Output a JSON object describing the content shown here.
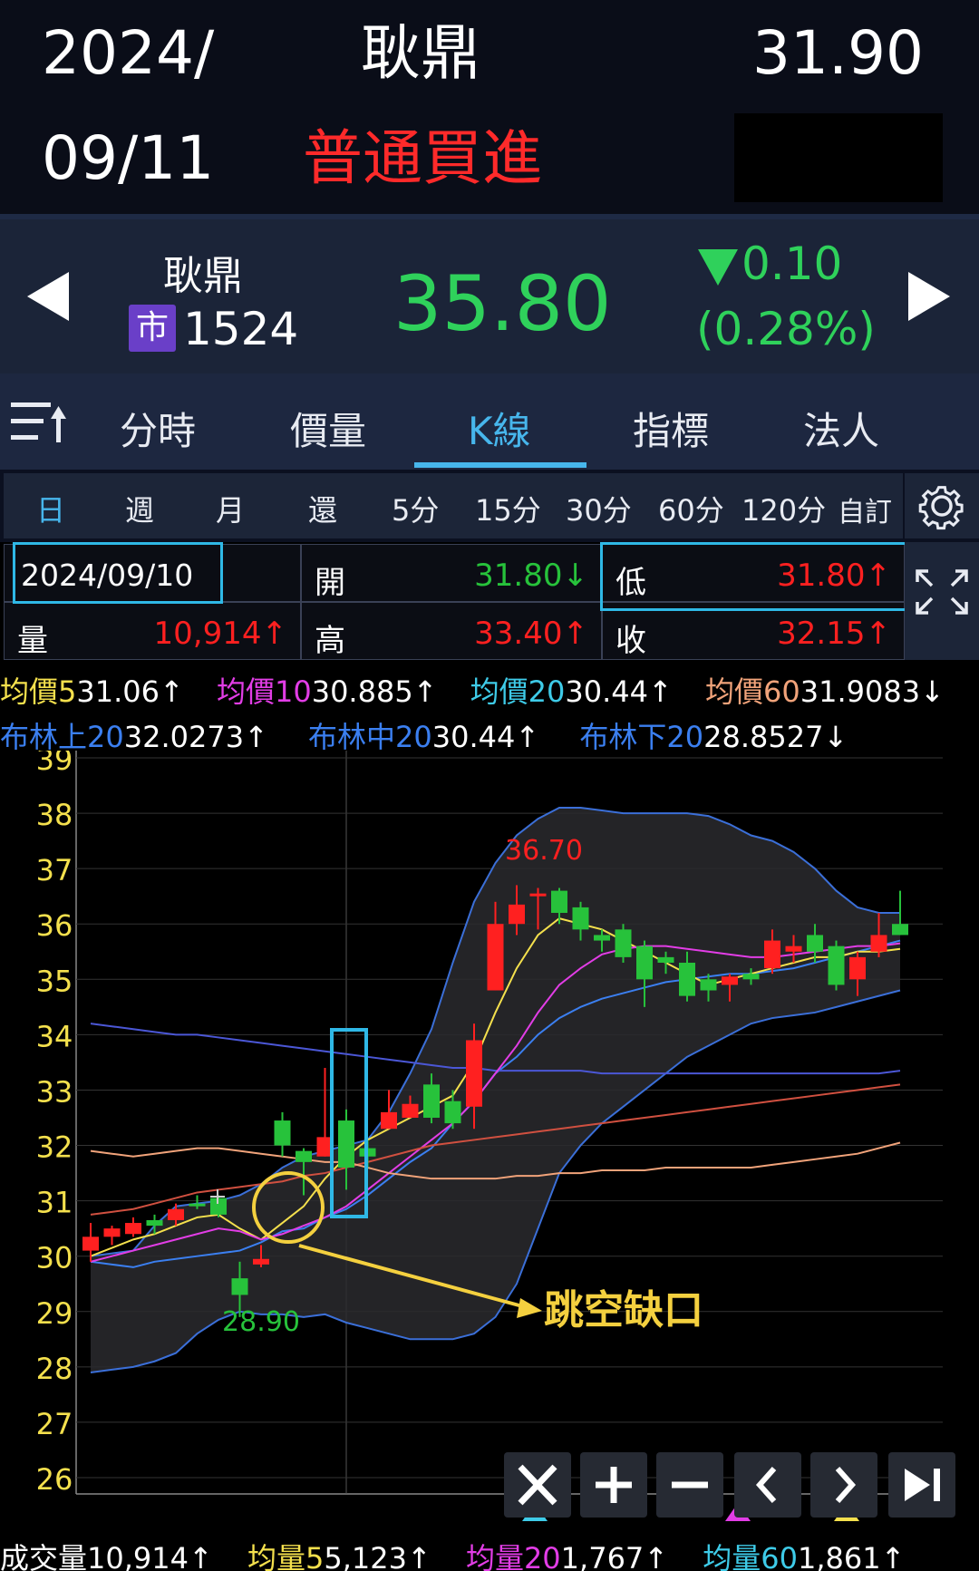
{
  "header": {
    "date_line1": "2024/",
    "date_line2": "09/11",
    "stock_name": "耿鼎",
    "action": "普通買進",
    "price": "31.90"
  },
  "quote": {
    "name": "耿鼎",
    "market_badge": "市",
    "code": "1524",
    "price": "35.80",
    "change": "0.10",
    "change_pct": "(0.28%)"
  },
  "tabs": [
    {
      "label": "分時"
    },
    {
      "label": "價量"
    },
    {
      "label": "K線"
    },
    {
      "label": "指標"
    },
    {
      "label": "法人"
    }
  ],
  "periods": [
    "日",
    "週",
    "月",
    "還",
    "5分",
    "15分",
    "30分",
    "60分",
    "120分"
  ],
  "custom_label": "自訂",
  "info": {
    "date": "2024/09/10",
    "open_label": "開",
    "open": "31.80↓",
    "low_label": "低",
    "low": "31.80↑",
    "vol_label": "量",
    "vol": "10,914↑",
    "high_label": "高",
    "high": "33.40↑",
    "close_label": "收",
    "close": "32.15↑"
  },
  "ma": {
    "ma5_label": "均價5",
    "ma5": "31.06↑",
    "ma10_label": "均價10",
    "ma10": "30.885↑",
    "ma20_label": "均價20",
    "ma20": "30.44↑",
    "ma60_label": "均價60",
    "ma60": "31.9083↓",
    "bu_label": "布林上20",
    "bu": "32.0273↑",
    "bm_label": "布林中20",
    "bm": "30.44↑",
    "bl_label": "布林下20",
    "bl": "28.8527↓"
  },
  "chart_data": {
    "type": "candlestick",
    "y_ticks": [
      "39",
      "38",
      "37",
      "36",
      "35",
      "34",
      "33",
      "32",
      "31",
      "30",
      "29",
      "28",
      "27",
      "26"
    ],
    "ylim": [
      25.5,
      39.1
    ],
    "candles": [
      {
        "o": 30.1,
        "h": 30.6,
        "l": 29.9,
        "c": 30.35,
        "up": true
      },
      {
        "o": 30.35,
        "h": 30.55,
        "l": 30.2,
        "c": 30.5,
        "up": true
      },
      {
        "o": 30.4,
        "h": 30.7,
        "l": 30.35,
        "c": 30.6,
        "up": true
      },
      {
        "o": 30.55,
        "h": 30.75,
        "l": 30.4,
        "c": 30.65,
        "up": false
      },
      {
        "o": 30.65,
        "h": 30.95,
        "l": 30.55,
        "c": 30.85,
        "up": true
      },
      {
        "o": 30.95,
        "h": 31.1,
        "l": 30.85,
        "c": 30.95,
        "up": false
      },
      {
        "o": 31.05,
        "h": 31.1,
        "l": 30.7,
        "c": 30.75,
        "up": false
      },
      {
        "o": 29.6,
        "h": 29.9,
        "l": 28.9,
        "c": 29.3,
        "up": false
      },
      {
        "o": 29.95,
        "h": 30.2,
        "l": 29.8,
        "c": 29.85,
        "up": true
      },
      {
        "o": 32.45,
        "h": 32.6,
        "l": 31.8,
        "c": 32.0,
        "up": false
      },
      {
        "o": 31.7,
        "h": 31.95,
        "l": 31.1,
        "c": 31.9,
        "up": false
      },
      {
        "o": 31.8,
        "h": 33.4,
        "l": 31.8,
        "c": 32.15,
        "up": true
      },
      {
        "o": 32.45,
        "h": 32.65,
        "l": 31.2,
        "c": 31.6,
        "up": false
      },
      {
        "o": 31.8,
        "h": 32.1,
        "l": 31.6,
        "c": 31.95,
        "up": false
      },
      {
        "o": 32.3,
        "h": 33.0,
        "l": 32.3,
        "c": 32.6,
        "up": true
      },
      {
        "o": 32.5,
        "h": 32.9,
        "l": 32.5,
        "c": 32.75,
        "up": true
      },
      {
        "o": 33.1,
        "h": 33.3,
        "l": 32.4,
        "c": 32.5,
        "up": false
      },
      {
        "o": 32.8,
        "h": 33.0,
        "l": 32.3,
        "c": 32.4,
        "up": false
      },
      {
        "o": 32.7,
        "h": 34.2,
        "l": 32.3,
        "c": 33.9,
        "up": true
      },
      {
        "o": 34.8,
        "h": 36.4,
        "l": 34.8,
        "c": 36.0,
        "up": true
      },
      {
        "o": 36.0,
        "h": 36.7,
        "l": 35.8,
        "c": 36.35,
        "up": true
      },
      {
        "o": 36.5,
        "h": 36.65,
        "l": 35.9,
        "c": 36.55,
        "up": true
      },
      {
        "o": 36.6,
        "h": 36.65,
        "l": 36.0,
        "c": 36.2,
        "up": false
      },
      {
        "o": 36.3,
        "h": 36.4,
        "l": 35.7,
        "c": 35.9,
        "up": false
      },
      {
        "o": 35.8,
        "h": 35.9,
        "l": 35.5,
        "c": 35.7,
        "up": false
      },
      {
        "o": 35.9,
        "h": 36.0,
        "l": 35.3,
        "c": 35.4,
        "up": false
      },
      {
        "o": 35.6,
        "h": 35.7,
        "l": 34.5,
        "c": 35.0,
        "up": false
      },
      {
        "o": 35.4,
        "h": 35.5,
        "l": 35.1,
        "c": 35.3,
        "up": false
      },
      {
        "o": 35.3,
        "h": 35.5,
        "l": 34.6,
        "c": 34.7,
        "up": false
      },
      {
        "o": 35.0,
        "h": 35.1,
        "l": 34.6,
        "c": 34.8,
        "up": false
      },
      {
        "o": 34.9,
        "h": 35.1,
        "l": 34.6,
        "c": 35.05,
        "up": true
      },
      {
        "o": 35.1,
        "h": 35.2,
        "l": 34.9,
        "c": 35.0,
        "up": false
      },
      {
        "o": 35.2,
        "h": 35.9,
        "l": 35.1,
        "c": 35.7,
        "up": true
      },
      {
        "o": 35.5,
        "h": 35.8,
        "l": 35.3,
        "c": 35.6,
        "up": true
      },
      {
        "o": 35.8,
        "h": 36.0,
        "l": 35.3,
        "c": 35.5,
        "up": false
      },
      {
        "o": 35.6,
        "h": 35.7,
        "l": 34.8,
        "c": 34.9,
        "up": false
      },
      {
        "o": 35.0,
        "h": 35.5,
        "l": 34.7,
        "c": 35.4,
        "up": true
      },
      {
        "o": 35.5,
        "h": 36.2,
        "l": 35.4,
        "c": 35.8,
        "up": true
      },
      {
        "o": 36.0,
        "h": 36.6,
        "l": 35.8,
        "c": 35.8,
        "up": false
      }
    ],
    "labels": {
      "high": "36.70",
      "low": "28.90",
      "gap": "跳空缺口"
    },
    "series": [
      {
        "name": "布林上20",
        "values": [
          30.0,
          30.05,
          30.1,
          30.55,
          30.9,
          30.95,
          31.0,
          31.1,
          31.3,
          31.6,
          31.8,
          31.9,
          32.0,
          32.1,
          32.6,
          33.3,
          34.1,
          35.3,
          36.4,
          37.1,
          37.6,
          37.9,
          38.1,
          38.1,
          38.05,
          38.0,
          38.0,
          38.0,
          38.0,
          37.95,
          37.8,
          37.6,
          37.5,
          37.3,
          37.0,
          36.6,
          36.3,
          36.2,
          36.2
        ]
      },
      {
        "name": "布林中20",
        "values": [
          29.9,
          29.85,
          29.8,
          29.9,
          29.95,
          30.0,
          30.05,
          30.1,
          30.25,
          30.45,
          30.5,
          30.7,
          30.85,
          31.1,
          31.4,
          31.7,
          31.95,
          32.4,
          32.8,
          33.3,
          33.6,
          34.0,
          34.3,
          34.5,
          34.65,
          34.75,
          34.85,
          34.95,
          35.0,
          35.05,
          35.1,
          35.1,
          35.15,
          35.2,
          35.3,
          35.4,
          35.5,
          35.6,
          35.7
        ]
      },
      {
        "name": "布林下20",
        "values": [
          27.9,
          27.95,
          28.0,
          28.1,
          28.25,
          28.6,
          28.85,
          29.0,
          28.95,
          28.95,
          28.9,
          28.95,
          28.8,
          28.7,
          28.6,
          28.5,
          28.5,
          28.5,
          28.6,
          28.9,
          29.5,
          30.5,
          31.5,
          32.0,
          32.4,
          32.7,
          33.0,
          33.3,
          33.6,
          33.8,
          34.0,
          34.2,
          34.3,
          34.35,
          34.4,
          34.5,
          34.6,
          34.7,
          34.8
        ]
      },
      {
        "name": "均價60",
        "values": [
          34.2,
          34.15,
          34.1,
          34.05,
          34.0,
          34.0,
          33.95,
          33.9,
          33.85,
          33.8,
          33.75,
          33.7,
          33.65,
          33.6,
          33.55,
          33.5,
          33.45,
          33.4,
          33.4,
          33.35,
          33.35,
          33.35,
          33.35,
          33.35,
          33.3,
          33.3,
          33.3,
          33.3,
          33.3,
          33.3,
          33.3,
          33.3,
          33.3,
          33.3,
          33.3,
          33.3,
          33.3,
          33.3,
          33.35
        ]
      },
      {
        "name": "均價5",
        "values": [
          30.0,
          30.15,
          30.3,
          30.4,
          30.55,
          30.7,
          30.75,
          30.5,
          30.3,
          30.6,
          30.9,
          31.4,
          31.8,
          32.1,
          32.3,
          32.5,
          32.7,
          32.9,
          33.5,
          34.4,
          35.2,
          35.8,
          36.1,
          36.0,
          35.9,
          35.7,
          35.5,
          35.3,
          35.1,
          34.9,
          35.0,
          35.1,
          35.2,
          35.3,
          35.4,
          35.4,
          35.5,
          35.5,
          35.55
        ]
      },
      {
        "name": "均價10",
        "values": [
          29.9,
          30.0,
          30.1,
          30.2,
          30.3,
          30.4,
          30.5,
          30.45,
          30.3,
          30.4,
          30.55,
          30.7,
          30.9,
          31.2,
          31.5,
          31.8,
          32.1,
          32.4,
          32.8,
          33.3,
          33.8,
          34.4,
          34.9,
          35.2,
          35.45,
          35.55,
          35.6,
          35.6,
          35.55,
          35.5,
          35.45,
          35.4,
          35.4,
          35.45,
          35.5,
          35.55,
          35.6,
          35.6,
          35.65
        ]
      },
      {
        "name": "均價20",
        "values": [
          30.75,
          30.8,
          30.85,
          30.95,
          31.05,
          31.15,
          31.2,
          31.25,
          31.3,
          31.35,
          31.45,
          31.5,
          31.6,
          31.7,
          31.8,
          31.9,
          32.0,
          32.05,
          32.1,
          32.15,
          32.2,
          32.25,
          32.3,
          32.35,
          32.4,
          32.45,
          32.5,
          32.55,
          32.6,
          32.65,
          32.7,
          32.75,
          32.8,
          32.85,
          32.9,
          32.95,
          33.0,
          33.05,
          33.1
        ]
      },
      {
        "name": "均價60b",
        "values": [
          31.9,
          31.85,
          31.8,
          31.85,
          31.9,
          31.95,
          31.95,
          31.9,
          31.85,
          31.8,
          31.75,
          31.7,
          31.7,
          31.6,
          31.5,
          31.45,
          31.4,
          31.4,
          31.4,
          31.4,
          31.45,
          31.45,
          31.5,
          31.5,
          31.55,
          31.55,
          31.55,
          31.6,
          31.6,
          31.6,
          31.6,
          31.6,
          31.65,
          31.7,
          31.75,
          31.8,
          31.85,
          31.95,
          32.05
        ]
      }
    ]
  },
  "volume": {
    "label": "成交量",
    "value": "10,914↑",
    "v5_label": "均量5",
    "v5": "5,123↑",
    "v20_label": "均量20",
    "v20": "1,767↑",
    "v60_label": "均量60",
    "v60": "1,861↑"
  },
  "colors": {
    "up": "#ff2020",
    "down": "#27c23b",
    "accent": "#47b6ec"
  }
}
